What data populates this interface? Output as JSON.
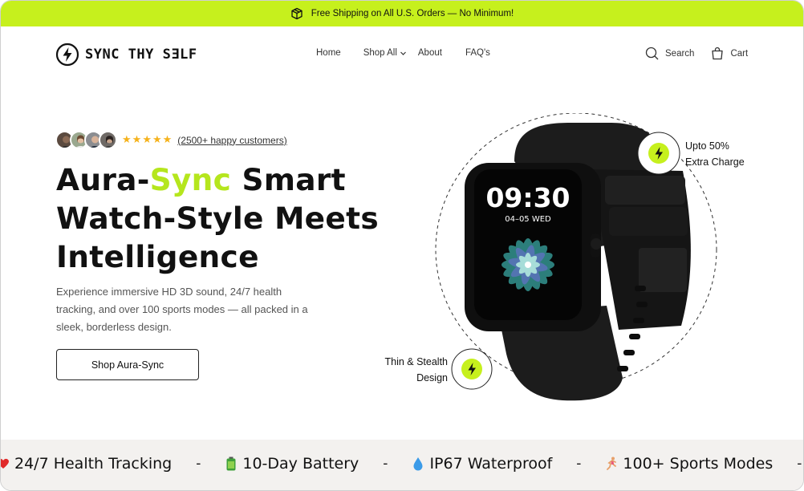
{
  "announcement": {
    "text": "Free Shipping on All U.S. Orders — No Minimum!",
    "icon": "box-icon"
  },
  "brand": {
    "name": "SYNC THY SƎLF",
    "icon": "lightning-icon"
  },
  "nav": [
    {
      "label": "Home"
    },
    {
      "label": "Shop All",
      "icon": "chevron-down-icon"
    },
    {
      "label": "About"
    },
    {
      "label": "FAQ's"
    }
  ],
  "header_actions": {
    "search_label": "Search",
    "cart_label": "Cart"
  },
  "hero": {
    "rating_stars": 5,
    "customers_text": "(2500+ happy customers)",
    "title_part1": "Aura-",
    "title_accent": "Sync",
    "title_part2": " Smart",
    "title_line2": "Watch-Style Meets",
    "title_line3": "Intelligence",
    "description": "Experience immersive HD 3D sound, 24/7 health tracking, and over 100 sports modes — all packed in a sleek, borderless design.",
    "cta_label": "Shop Aura-Sync"
  },
  "watch": {
    "time": "09:30",
    "date": "04–05 WED"
  },
  "features": {
    "top_line1": "Upto 50%",
    "top_line2": "Extra Charge",
    "bottom_line1": "Thin & Stealth",
    "bottom_line2": "Design"
  },
  "marquee": [
    {
      "icon": "heart-icon",
      "label": "24/7 Health Tracking"
    },
    {
      "icon": "battery-icon",
      "label": "10-Day Battery"
    },
    {
      "icon": "droplet-icon",
      "label": "IP67 Waterproof"
    },
    {
      "icon": "runner-icon",
      "label": "100+ Sports Modes"
    }
  ],
  "marquee_separator": "-",
  "colors": {
    "accent": "#c6f01d",
    "accent_text": "#b5e61d",
    "text": "#111111",
    "marquee_bg": "#f3f1ef"
  }
}
